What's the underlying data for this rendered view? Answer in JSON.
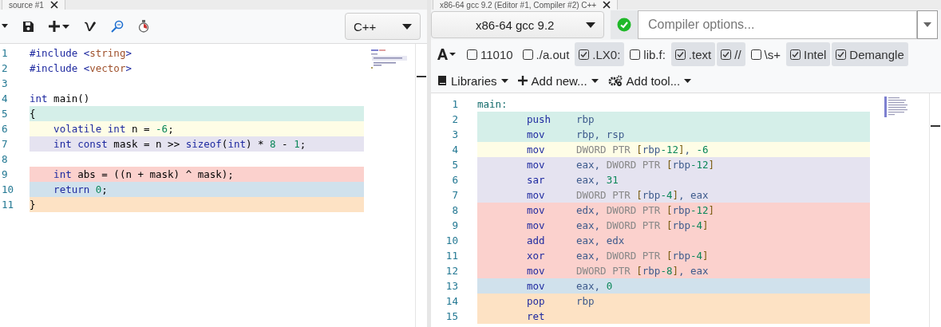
{
  "source_pane": {
    "tab_title": "source #1",
    "language": "C++",
    "lines": [
      {
        "number": "1",
        "tokens": [
          {
            "t": "#include ",
            "kind": "kw"
          },
          {
            "t": "<",
            "kind": "kw"
          },
          {
            "t": "string",
            "kind": "str"
          },
          {
            "t": ">",
            "kind": "kw"
          }
        ]
      },
      {
        "number": "2",
        "tokens": [
          {
            "t": "#include ",
            "kind": "kw"
          },
          {
            "t": "<",
            "kind": "kw"
          },
          {
            "t": "vector",
            "kind": "str"
          },
          {
            "t": ">",
            "kind": "kw"
          }
        ]
      },
      {
        "number": "3"
      },
      {
        "number": "4",
        "tokens": [
          {
            "t": "int",
            "kind": "kw"
          },
          {
            "t": " main()",
            "kind": "plain"
          }
        ]
      },
      {
        "number": "5",
        "color": "#d5efe9",
        "tokens": [
          {
            "t": "{",
            "kind": "plain"
          }
        ]
      },
      {
        "number": "6",
        "color": "#fefde6",
        "tokens": [
          {
            "t": "    volatile int",
            "kind": "kw"
          },
          {
            "t": " n = ",
            "kind": "plain"
          },
          {
            "t": "-6",
            "kind": "num"
          },
          {
            "t": ";",
            "kind": "plain"
          }
        ]
      },
      {
        "number": "7",
        "color": "#e5e3f0",
        "tokens": [
          {
            "t": "    int const",
            "kind": "kw"
          },
          {
            "t": " mask = n >> ",
            "kind": "plain"
          },
          {
            "t": "sizeof",
            "kind": "kw"
          },
          {
            "t": "(",
            "kind": "plain"
          },
          {
            "t": "int",
            "kind": "kw"
          },
          {
            "t": ") * ",
            "kind": "plain"
          },
          {
            "t": "8",
            "kind": "num"
          },
          {
            "t": " - ",
            "kind": "plain"
          },
          {
            "t": "1",
            "kind": "num"
          },
          {
            "t": ";",
            "kind": "plain"
          }
        ]
      },
      {
        "number": "8"
      },
      {
        "number": "9",
        "color": "#fbd1cd",
        "tokens": [
          {
            "t": "    int",
            "kind": "kw"
          },
          {
            "t": " abs = ((n + mask) ^ mask);",
            "kind": "plain"
          }
        ]
      },
      {
        "number": "10",
        "color": "#d0e1ec",
        "tokens": [
          {
            "t": "    return ",
            "kind": "kw"
          },
          {
            "t": "0",
            "kind": "num"
          },
          {
            "t": ";",
            "kind": "plain"
          }
        ]
      },
      {
        "number": "11",
        "color": "#fde2c4",
        "tokens": [
          {
            "t": "}",
            "kind": "plain"
          }
        ]
      }
    ]
  },
  "compiler_pane": {
    "tab_title": "x86-64 gcc 9.2 (Editor #1, Compiler #2) C++",
    "compiler": "x86-64 gcc 9.2",
    "options_placeholder": "Compiler options...",
    "filters": [
      {
        "label": "11010",
        "checked": false
      },
      {
        "label": "./a.out",
        "checked": false
      },
      {
        "label": ".LX0:",
        "checked": true
      },
      {
        "label": "lib.f:",
        "checked": false
      },
      {
        "label": ".text",
        "checked": true
      },
      {
        "label": "//",
        "checked": true
      },
      {
        "label": "\\s+",
        "checked": false
      },
      {
        "label": "Intel",
        "checked": true
      },
      {
        "label": "Demangle",
        "checked": true
      }
    ],
    "menus": [
      {
        "kind": "libraries",
        "label": "Libraries"
      },
      {
        "kind": "add",
        "label": "Add new..."
      },
      {
        "kind": "tool",
        "label": "Add tool..."
      }
    ],
    "lines": [
      {
        "number": "1",
        "label": "main:"
      },
      {
        "number": "2",
        "color": "#d5efe9",
        "mnemonic": "push",
        "operands": [
          {
            "t": "rbp",
            "kind": "reg"
          }
        ]
      },
      {
        "number": "3",
        "color": "#d5efe9",
        "mnemonic": "mov",
        "operands": [
          {
            "t": "rbp, rsp",
            "kind": "reg"
          }
        ]
      },
      {
        "number": "4",
        "color": "#fefde6",
        "mnemonic": "mov",
        "operands": [
          {
            "t": "DWORD PTR ",
            "kind": "ptr"
          },
          {
            "t": "[",
            "kind": "br"
          },
          {
            "t": "rbp",
            "kind": "reg"
          },
          {
            "t": "-12",
            "kind": "num"
          },
          {
            "t": "]",
            "kind": "br"
          },
          {
            "t": ", ",
            "kind": "reg"
          },
          {
            "t": "-6",
            "kind": "num"
          }
        ]
      },
      {
        "number": "5",
        "color": "#e5e3f0",
        "mnemonic": "mov",
        "operands": [
          {
            "t": "eax, ",
            "kind": "reg"
          },
          {
            "t": "DWORD PTR ",
            "kind": "ptr"
          },
          {
            "t": "[",
            "kind": "br"
          },
          {
            "t": "rbp",
            "kind": "reg"
          },
          {
            "t": "-12",
            "kind": "num"
          },
          {
            "t": "]",
            "kind": "br"
          }
        ]
      },
      {
        "number": "6",
        "color": "#e5e3f0",
        "mnemonic": "sar",
        "operands": [
          {
            "t": "eax, ",
            "kind": "reg"
          },
          {
            "t": "31",
            "kind": "num"
          }
        ]
      },
      {
        "number": "7",
        "color": "#e5e3f0",
        "mnemonic": "mov",
        "operands": [
          {
            "t": "DWORD PTR ",
            "kind": "ptr"
          },
          {
            "t": "[",
            "kind": "br"
          },
          {
            "t": "rbp",
            "kind": "reg"
          },
          {
            "t": "-4",
            "kind": "num"
          },
          {
            "t": "]",
            "kind": "br"
          },
          {
            "t": ", eax",
            "kind": "reg"
          }
        ]
      },
      {
        "number": "8",
        "color": "#fbd1cd",
        "mnemonic": "mov",
        "operands": [
          {
            "t": "edx, ",
            "kind": "reg"
          },
          {
            "t": "DWORD PTR ",
            "kind": "ptr"
          },
          {
            "t": "[",
            "kind": "br"
          },
          {
            "t": "rbp",
            "kind": "reg"
          },
          {
            "t": "-12",
            "kind": "num"
          },
          {
            "t": "]",
            "kind": "br"
          }
        ]
      },
      {
        "number": "9",
        "color": "#fbd1cd",
        "mnemonic": "mov",
        "operands": [
          {
            "t": "eax, ",
            "kind": "reg"
          },
          {
            "t": "DWORD PTR ",
            "kind": "ptr"
          },
          {
            "t": "[",
            "kind": "br"
          },
          {
            "t": "rbp",
            "kind": "reg"
          },
          {
            "t": "-4",
            "kind": "num"
          },
          {
            "t": "]",
            "kind": "br"
          }
        ]
      },
      {
        "number": "10",
        "color": "#fbd1cd",
        "mnemonic": "add",
        "operands": [
          {
            "t": "eax, edx",
            "kind": "reg"
          }
        ]
      },
      {
        "number": "11",
        "color": "#fbd1cd",
        "mnemonic": "xor",
        "operands": [
          {
            "t": "eax, ",
            "kind": "reg"
          },
          {
            "t": "DWORD PTR ",
            "kind": "ptr"
          },
          {
            "t": "[",
            "kind": "br"
          },
          {
            "t": "rbp",
            "kind": "reg"
          },
          {
            "t": "-4",
            "kind": "num"
          },
          {
            "t": "]",
            "kind": "br"
          }
        ]
      },
      {
        "number": "12",
        "color": "#fbd1cd",
        "mnemonic": "mov",
        "operands": [
          {
            "t": "DWORD PTR ",
            "kind": "ptr"
          },
          {
            "t": "[",
            "kind": "br"
          },
          {
            "t": "rbp",
            "kind": "reg"
          },
          {
            "t": "-8",
            "kind": "num"
          },
          {
            "t": "]",
            "kind": "br"
          },
          {
            "t": ", eax",
            "kind": "reg"
          }
        ]
      },
      {
        "number": "13",
        "color": "#d0e1ec",
        "mnemonic": "mov",
        "operands": [
          {
            "t": "eax, ",
            "kind": "reg"
          },
          {
            "t": "0",
            "kind": "num"
          }
        ]
      },
      {
        "number": "14",
        "color": "#fde2c4",
        "mnemonic": "pop",
        "operands": [
          {
            "t": "rbp",
            "kind": "reg"
          }
        ]
      },
      {
        "number": "15",
        "color": "#fde2c4",
        "mnemonic": "ret"
      }
    ]
  }
}
